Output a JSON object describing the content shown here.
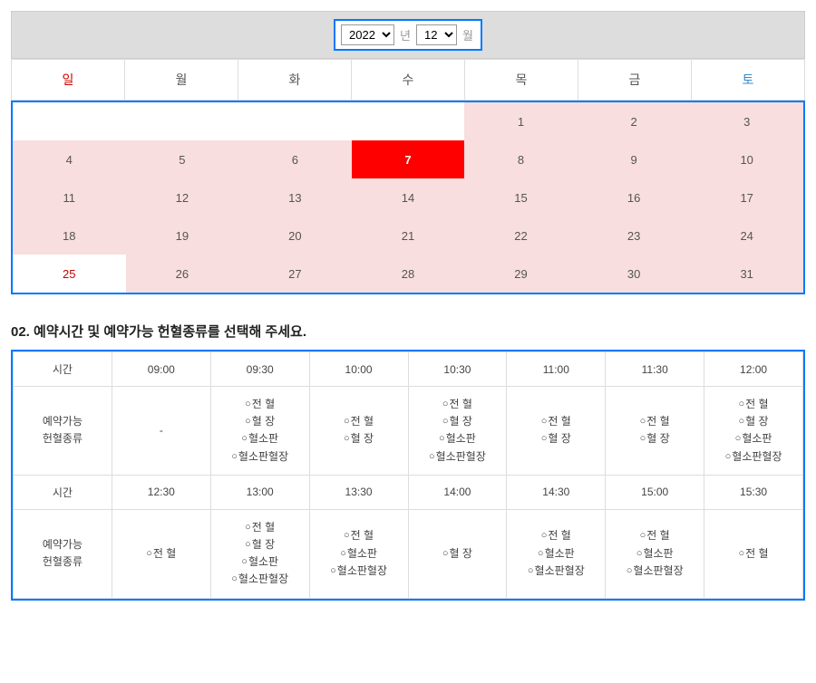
{
  "date_picker": {
    "year_selected": "2022",
    "year_label": "년",
    "month_selected": "12",
    "month_label": "월"
  },
  "calendar": {
    "day_headers": [
      "일",
      "월",
      "화",
      "수",
      "목",
      "금",
      "토"
    ],
    "weeks": [
      [
        {
          "d": "",
          "cls": ""
        },
        {
          "d": "",
          "cls": ""
        },
        {
          "d": "",
          "cls": ""
        },
        {
          "d": "",
          "cls": ""
        },
        {
          "d": "1",
          "cls": "avail"
        },
        {
          "d": "2",
          "cls": "avail"
        },
        {
          "d": "3",
          "cls": "avail"
        }
      ],
      [
        {
          "d": "4",
          "cls": "avail"
        },
        {
          "d": "5",
          "cls": "avail"
        },
        {
          "d": "6",
          "cls": "avail"
        },
        {
          "d": "7",
          "cls": "selected"
        },
        {
          "d": "8",
          "cls": "avail"
        },
        {
          "d": "9",
          "cls": "avail"
        },
        {
          "d": "10",
          "cls": "avail"
        }
      ],
      [
        {
          "d": "11",
          "cls": "avail"
        },
        {
          "d": "12",
          "cls": "avail"
        },
        {
          "d": "13",
          "cls": "avail"
        },
        {
          "d": "14",
          "cls": "avail"
        },
        {
          "d": "15",
          "cls": "avail"
        },
        {
          "d": "16",
          "cls": "avail"
        },
        {
          "d": "17",
          "cls": "avail"
        }
      ],
      [
        {
          "d": "18",
          "cls": "avail"
        },
        {
          "d": "19",
          "cls": "avail"
        },
        {
          "d": "20",
          "cls": "avail"
        },
        {
          "d": "21",
          "cls": "avail"
        },
        {
          "d": "22",
          "cls": "avail"
        },
        {
          "d": "23",
          "cls": "avail"
        },
        {
          "d": "24",
          "cls": "avail"
        }
      ],
      [
        {
          "d": "25",
          "cls": "sun"
        },
        {
          "d": "26",
          "cls": "avail"
        },
        {
          "d": "27",
          "cls": "avail"
        },
        {
          "d": "28",
          "cls": "avail"
        },
        {
          "d": "29",
          "cls": "avail"
        },
        {
          "d": "30",
          "cls": "avail"
        },
        {
          "d": "31",
          "cls": "avail"
        }
      ]
    ]
  },
  "section2": {
    "title": "02. 예약시간 및 예약가능 헌혈종류를 선택해 주세요.",
    "labels": {
      "time": "시간",
      "avail_type": "예약가능\n헌혈종류"
    },
    "opt_names": {
      "whole": "전  혈",
      "plasma": "혈  장",
      "platelet": "혈소판",
      "platelet_plasma": "혈소판혈장"
    },
    "rows": [
      {
        "times": [
          "09:00",
          "09:30",
          "10:00",
          "10:30",
          "11:00",
          "11:30",
          "12:00"
        ],
        "slots": [
          [
            "-"
          ],
          [
            "whole",
            "plasma",
            "platelet",
            "platelet_plasma"
          ],
          [
            "whole",
            "plasma"
          ],
          [
            "whole",
            "plasma",
            "platelet",
            "platelet_plasma"
          ],
          [
            "whole",
            "plasma"
          ],
          [
            "whole",
            "plasma"
          ],
          [
            "whole",
            "plasma",
            "platelet",
            "platelet_plasma"
          ]
        ]
      },
      {
        "times": [
          "12:30",
          "13:00",
          "13:30",
          "14:00",
          "14:30",
          "15:00",
          "15:30"
        ],
        "slots": [
          [
            "whole"
          ],
          [
            "whole",
            "plasma",
            "platelet",
            "platelet_plasma"
          ],
          [
            "whole",
            "platelet",
            "platelet_plasma"
          ],
          [
            "plasma"
          ],
          [
            "whole",
            "platelet",
            "platelet_plasma"
          ],
          [
            "whole",
            "platelet",
            "platelet_plasma"
          ],
          [
            "whole"
          ]
        ]
      }
    ]
  }
}
